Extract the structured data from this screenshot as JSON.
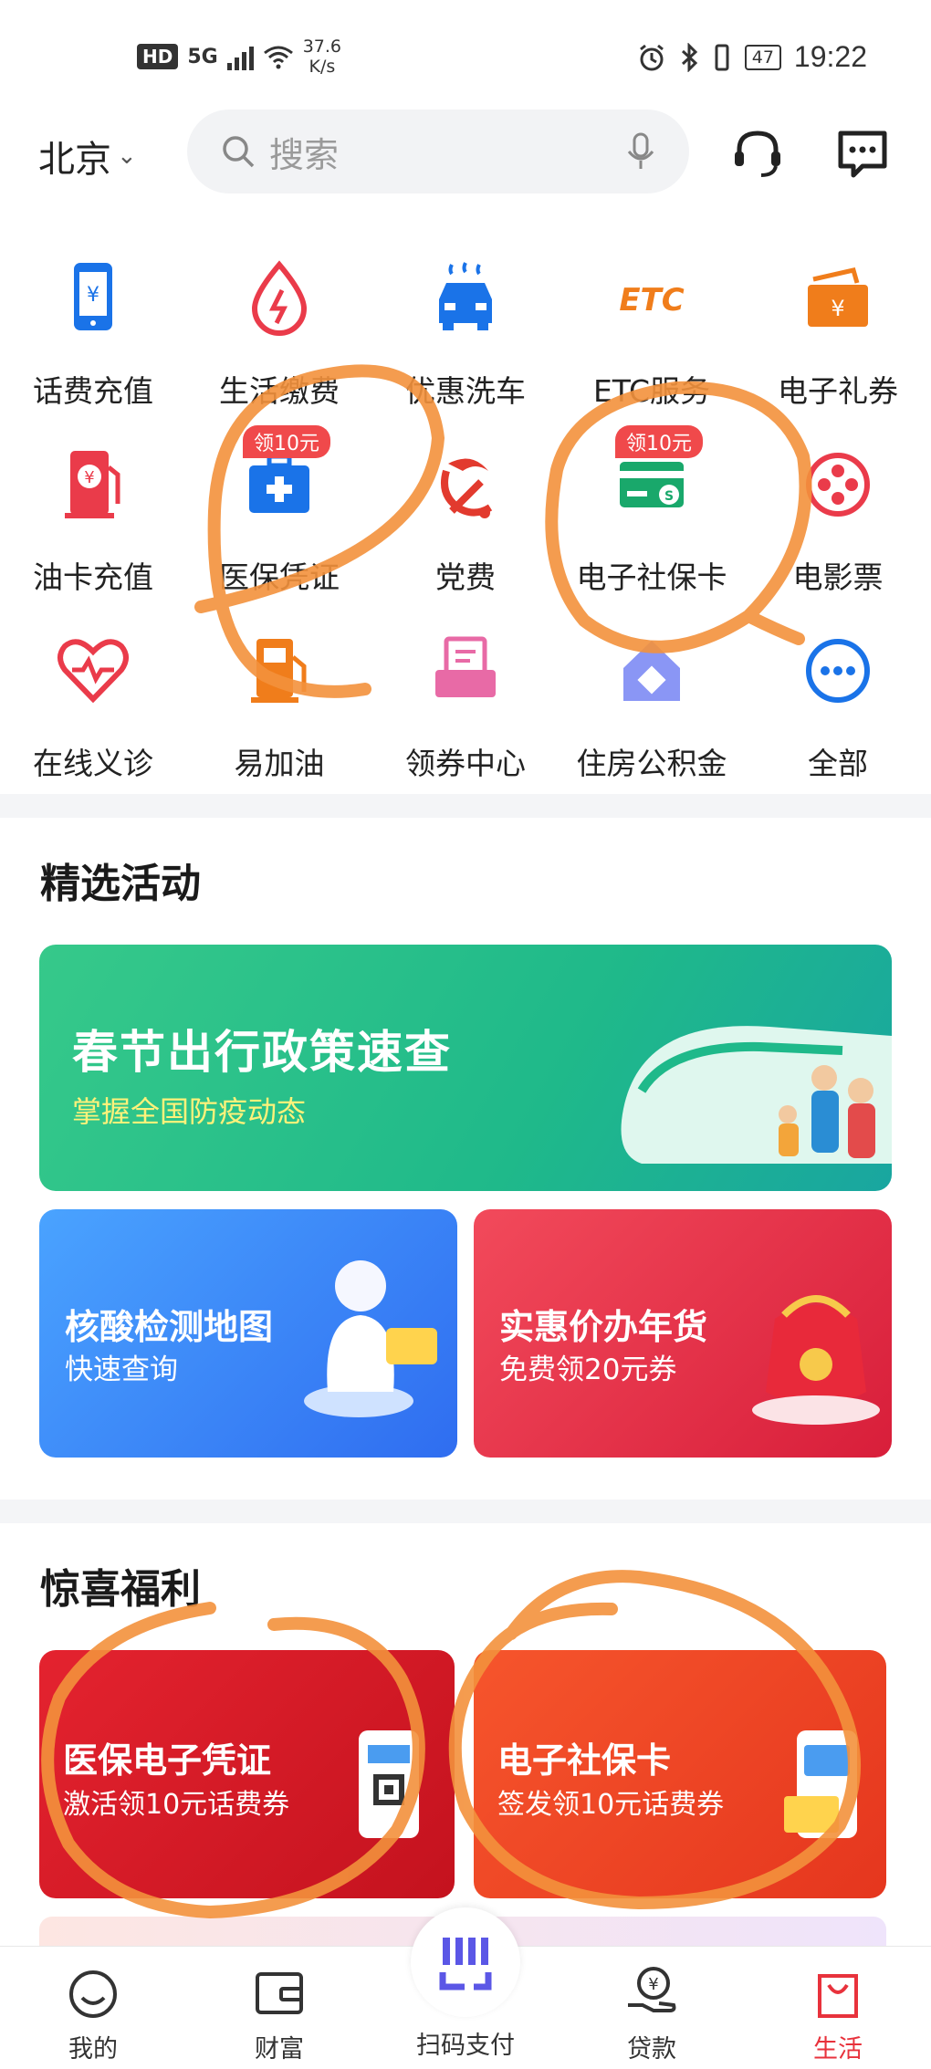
{
  "status_bar": {
    "hd": "HD",
    "network": "5G",
    "speed_value": "37.6",
    "speed_unit": "K/s",
    "battery": "47",
    "time": "19:22"
  },
  "header": {
    "city": "北京",
    "search_placeholder": "搜索"
  },
  "services": [
    {
      "label": "话费充值",
      "icon": "phone-recharge-icon",
      "color": "#1a73e8"
    },
    {
      "label": "生活缴费",
      "icon": "utility-drop-icon",
      "color": "#ea3b4a"
    },
    {
      "label": "优惠洗车",
      "icon": "car-wash-icon",
      "color": "#1a73e8"
    },
    {
      "label": "ETC服务",
      "icon": "etc-icon",
      "color": "#f07d1b"
    },
    {
      "label": "电子礼券",
      "icon": "gift-voucher-icon",
      "color": "#f07d1b"
    },
    {
      "label": "油卡充值",
      "icon": "fuel-card-icon",
      "color": "#ea3b4a"
    },
    {
      "label": "医保凭证",
      "icon": "medical-kit-icon",
      "color": "#1a73e8",
      "tag": "领10元"
    },
    {
      "label": "党费",
      "icon": "party-emblem-icon",
      "color": "#e23a2e"
    },
    {
      "label": "电子社保卡",
      "icon": "social-security-card-icon",
      "color": "#19a86b",
      "tag": "领10元"
    },
    {
      "label": "电影票",
      "icon": "film-reel-icon",
      "color": "#ea3b4a"
    },
    {
      "label": "在线义诊",
      "icon": "heart-pulse-icon",
      "color": "#ea3b4a"
    },
    {
      "label": "易加油",
      "icon": "gas-pump-icon",
      "color": "#f07d1b"
    },
    {
      "label": "领券中心",
      "icon": "coupon-center-icon",
      "color": "#e86aa6"
    },
    {
      "label": "住房公积金",
      "icon": "house-fund-icon",
      "color": "#6a7cf0"
    },
    {
      "label": "全部",
      "icon": "more-dots-icon",
      "color": "#1a73e8"
    }
  ],
  "featured": {
    "title": "精选活动",
    "banner": {
      "title": "春节出行政策速查",
      "subtitle": "掌握全国防疫动态"
    },
    "card_left": {
      "title": "核酸检测地图",
      "subtitle": "快速查询"
    },
    "card_right": {
      "title": "实惠价办年货",
      "subtitle": "免费领20元券"
    }
  },
  "perks": {
    "title": "惊喜福利",
    "card_left": {
      "title": "医保电子凭证",
      "subtitle": "激活领10元话费券"
    },
    "card_right": {
      "title": "电子社保卡",
      "subtitle": "签发领10元话费券"
    }
  },
  "tabs": [
    {
      "label": "我的",
      "icon": "profile-icon"
    },
    {
      "label": "财富",
      "icon": "wallet-icon"
    },
    {
      "label": "扫码支付",
      "icon": "scan-pay-icon"
    },
    {
      "label": "贷款",
      "icon": "loan-icon"
    },
    {
      "label": "生活",
      "icon": "shopping-bag-icon",
      "active": true
    }
  ],
  "colors": {
    "accent_blue": "#1a73e8",
    "active_tab": "#e8323c",
    "annotation_orange": "#f3913c"
  }
}
